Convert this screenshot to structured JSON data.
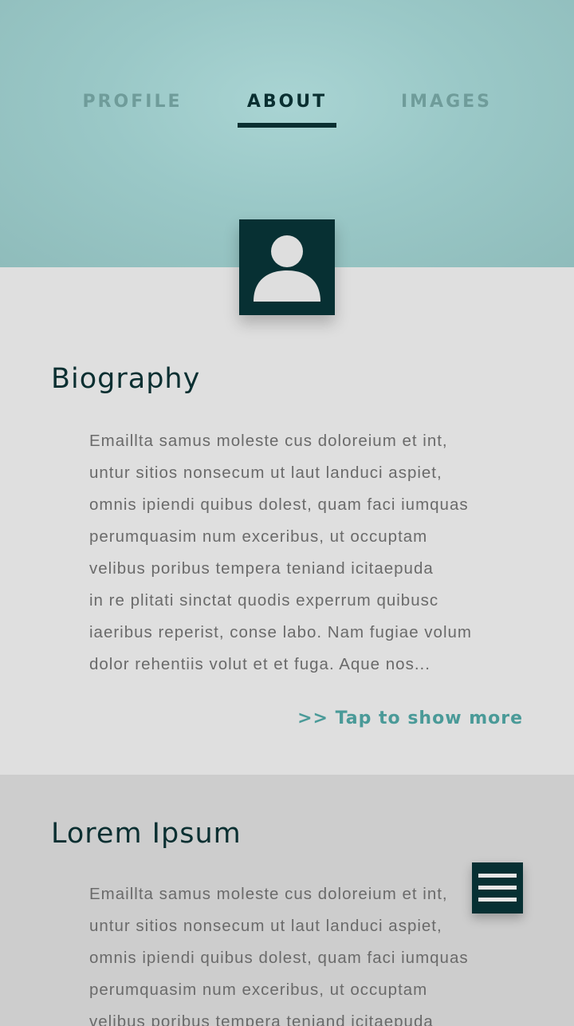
{
  "tabs": [
    {
      "label": "PROFILE"
    },
    {
      "label": "ABOUT"
    },
    {
      "label": "IMAGES"
    }
  ],
  "active_tab": "ABOUT",
  "avatar": {
    "icon": "user-icon"
  },
  "biography": {
    "title": "Biography",
    "lines": [
      "Emaillta samus moleste cus doloreium et int,",
      "untur sitios nonsecum ut laut landuci aspiet,",
      "omnis ipiendi quibus dolest, quam faci iumquas",
      "perumquasim num exceribus, ut occuptam",
      "velibus poribus tempera teniand icitaepuda",
      "in re plitati sinctat quodis experrum quibusc",
      "iaeribus reperist, conse labo. Nam fugiae volum",
      "dolor rehentiis volut et et fuga. Aque nos..."
    ],
    "show_more": ">> Tap to show more"
  },
  "lorem": {
    "title": "Lorem Ipsum",
    "lines": [
      "Emaillta samus moleste cus doloreium et int,",
      "untur sitios nonsecum ut laut landuci aspiet,",
      "omnis ipiendi quibus dolest, quam faci iumquas",
      "perumquasim num exceribus, ut occuptam",
      "velibus poribus tempera teniand icitaepuda"
    ]
  },
  "menu_button": {
    "icon": "hamburger-menu-icon"
  },
  "colors": {
    "header_teal": "#9ac8c7",
    "dark_teal": "#073033",
    "accent_teal": "#4a9a98",
    "inactive_tab": "#6f9c9a"
  }
}
